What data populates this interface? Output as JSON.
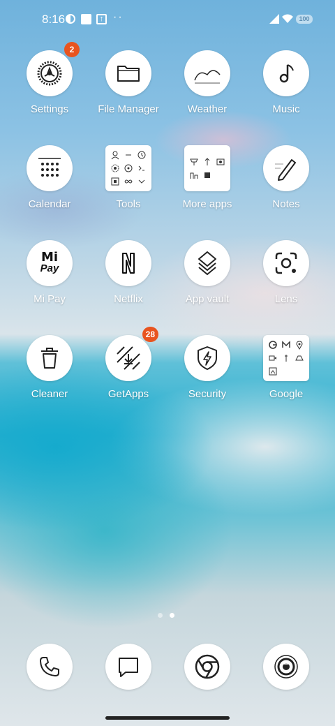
{
  "status_bar": {
    "time": "8:16",
    "battery": "100",
    "icons": [
      "notification-halfcircle-icon",
      "notification-square-icon",
      "upload-icon",
      "more-dots-icon",
      "signal-icon",
      "wifi-icon",
      "battery-icon"
    ]
  },
  "apps": [
    {
      "label": "Settings",
      "icon": "gear-icon",
      "badge": "2"
    },
    {
      "label": "File Manager",
      "icon": "folder-icon"
    },
    {
      "label": "Weather",
      "icon": "cloud-icon"
    },
    {
      "label": "Music",
      "icon": "music-note-icon"
    },
    {
      "label": "Calendar",
      "icon": "calendar-icon"
    },
    {
      "label": "Tools",
      "icon": "folder-icon"
    },
    {
      "label": "More apps",
      "icon": "folder-icon"
    },
    {
      "label": "Notes",
      "icon": "pencil-icon"
    },
    {
      "label": "Mi Pay",
      "icon": "mi-pay-icon",
      "icon_text_top": "Mi",
      "icon_text_bottom": "Pay"
    },
    {
      "label": "Netflix",
      "icon": "netflix-icon"
    },
    {
      "label": "App vault",
      "icon": "app-vault-icon"
    },
    {
      "label": "Lens",
      "icon": "lens-icon"
    },
    {
      "label": "Cleaner",
      "icon": "trash-icon"
    },
    {
      "label": "GetApps",
      "icon": "getapps-icon",
      "badge": "28"
    },
    {
      "label": "Security",
      "icon": "shield-bolt-icon"
    },
    {
      "label": "Google",
      "icon": "folder-icon"
    }
  ],
  "dock": [
    {
      "icon": "phone-icon"
    },
    {
      "icon": "messages-icon"
    },
    {
      "icon": "chrome-icon"
    },
    {
      "icon": "camera-icon"
    }
  ],
  "page_indicator": {
    "pages": 2,
    "current": 2
  },
  "colors": {
    "badge": "#e8541f",
    "icon_bg": "#ffffff",
    "label": "#ffffff"
  }
}
